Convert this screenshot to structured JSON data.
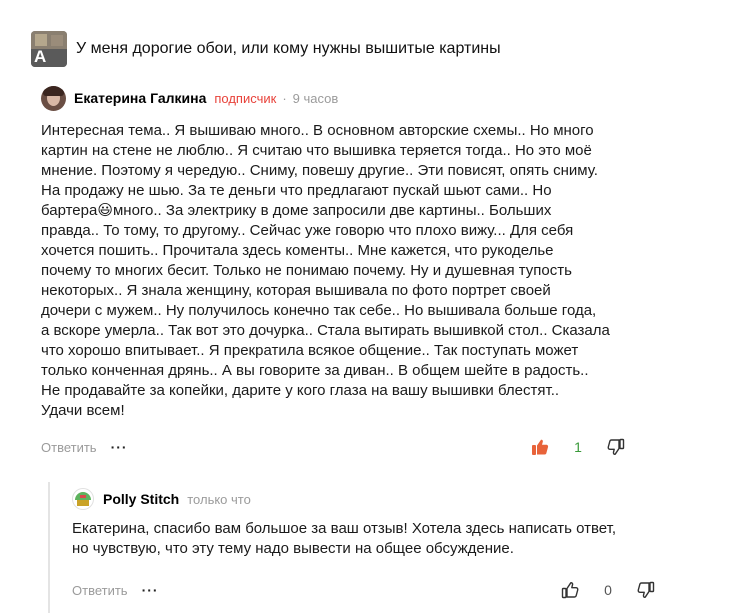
{
  "header": {
    "thumb_letter": "A",
    "title": "У меня дорогие обои, или кому нужны вышитые картины"
  },
  "comment": {
    "author": "Екатерина Галкина",
    "badge": "подписчик",
    "separator": "·",
    "time": "9 часов",
    "lines": [
      "Интересная тема.. Я вышиваю много.. В основном авторские схемы.. Но много",
      "картин на стене не люблю.. Я считаю что вышивка теряется тогда.. Но это моё",
      "мнение. Поэтому я чередую.. Сниму, повешу другие.. Эти повисят, опять сниму.",
      "На продажу не шью. За те деньги что предлагают пускай шьют сами.. Но",
      "бартера😃много.. За электрику в доме запросили две картины.. Больших",
      "правда.. То тому, то другому.. Сейчас уже говорю что плохо вижу... Для себя",
      "хочется пошить.. Прочитала здесь коменты.. Мне кажется, что рукоделье",
      "почему то многих бесит. Только не понимаю почему. Ну и душевная тупость",
      "некоторых.. Я знала женщину, которая вышивала по фото портрет своей",
      "дочери с мужем.. Ну получилось конечно так себе.. Но вышивала больше года,",
      "а вскоре умерла.. Так вот это дочурка.. Стала вытирать вышивкой стол.. Сказала",
      "что хорошо впитывает.. Я прекратила всякое общение.. Так поступать может",
      "только конченная дрянь.. А вы говорите за диван.. В общем шейте в радость..",
      "Не продавайте за копейки, дарите у кого глаза на вашу вышивки блестят..",
      "Удачи всем!"
    ],
    "reply_label": "Ответить",
    "more_label": "···",
    "like_count": "1",
    "like_color": "#e8633a",
    "count_color": "#3a9a3a"
  },
  "reply": {
    "author": "Polly Stitch",
    "time": "только что",
    "lines": [
      "Екатерина, спасибо вам большое за ваш отзыв! Хотела здесь написать ответ,",
      "но чувствую, что эту тему надо вывести на общее обсуждение."
    ],
    "reply_label": "Ответить",
    "more_label": "···",
    "like_count": "0"
  }
}
